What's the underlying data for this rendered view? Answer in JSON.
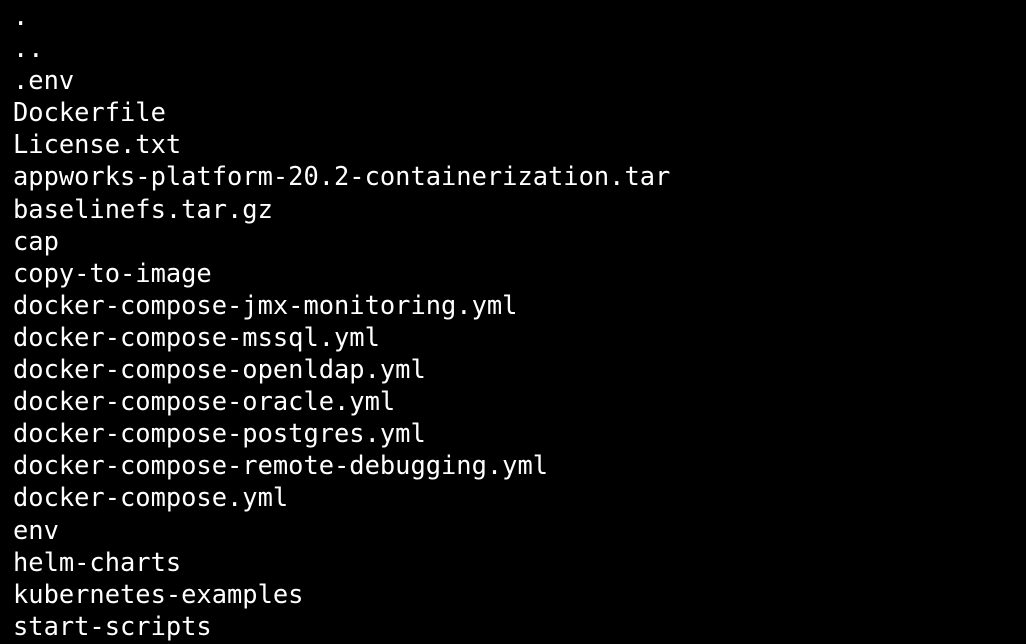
{
  "terminal": {
    "background_color": "#000000",
    "text_color": "#ffffff",
    "entries": [
      ".",
      "..",
      ".env",
      "Dockerfile",
      "License.txt",
      "appworks-platform-20.2-containerization.tar",
      "baselinefs.tar.gz",
      "cap",
      "copy-to-image",
      "docker-compose-jmx-monitoring.yml",
      "docker-compose-mssql.yml",
      "docker-compose-openldap.yml",
      "docker-compose-oracle.yml",
      "docker-compose-postgres.yml",
      "docker-compose-remote-debugging.yml",
      "docker-compose.yml",
      "env",
      "helm-charts",
      "kubernetes-examples",
      "start-scripts"
    ]
  }
}
